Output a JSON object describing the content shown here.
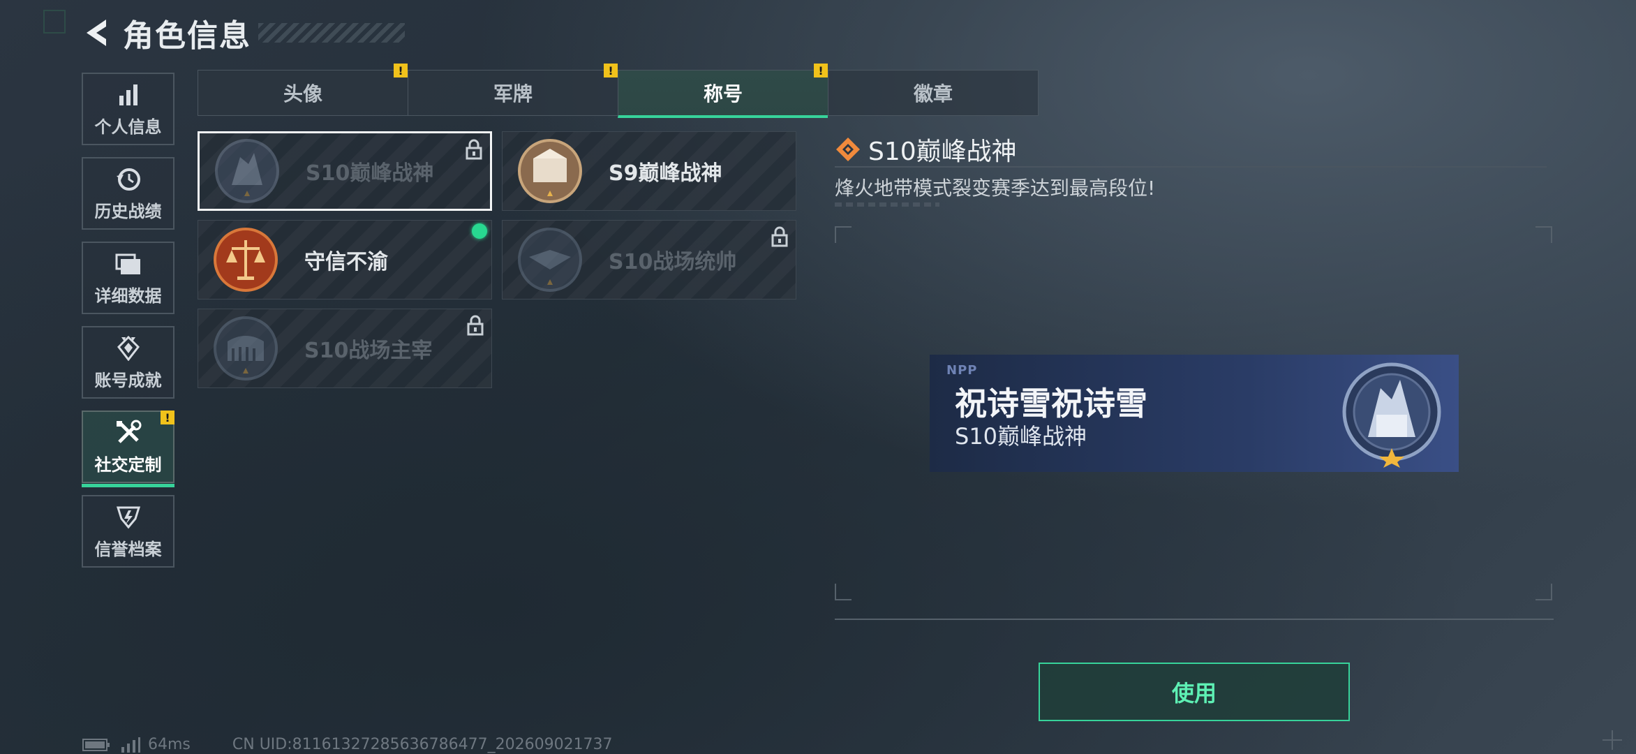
{
  "header": {
    "title": "角色信息"
  },
  "sidebar": {
    "items": [
      {
        "label": "个人信息",
        "icon": "bar-chart-icon"
      },
      {
        "label": "历史战绩",
        "icon": "history-clock-icon"
      },
      {
        "label": "详细数据",
        "icon": "folder-stack-icon"
      },
      {
        "label": "账号成就",
        "icon": "achievement-icon"
      },
      {
        "label": "社交定制",
        "icon": "tools-icon",
        "active": true,
        "alert": "!"
      },
      {
        "label": "信誉档案",
        "icon": "credit-shield-icon"
      }
    ]
  },
  "tabs": [
    {
      "label": "头像",
      "alert": "!"
    },
    {
      "label": "军牌",
      "alert": "!"
    },
    {
      "label": "称号",
      "alert": "!",
      "active": true
    },
    {
      "label": "徽章"
    }
  ],
  "titles": [
    {
      "name": "S10巅峰战神",
      "locked": true,
      "selected": true
    },
    {
      "name": "S9巅峰战神",
      "locked": false
    },
    {
      "name": "守信不渝",
      "locked": false,
      "equipped": true
    },
    {
      "name": "S10战场统帅",
      "locked": true
    },
    {
      "name": "S10战场主宰",
      "locked": true
    }
  ],
  "detail": {
    "name": "S10巅峰战神",
    "description": "烽火地带模式裂变赛季达到最高段位!"
  },
  "preview": {
    "brand": "NPP",
    "player_name": "祝诗雪祝诗雪",
    "title": "S10巅峰战神"
  },
  "actions": {
    "use_label": "使用"
  },
  "footer": {
    "ping": "64ms",
    "uid": "CN UID:8116132728563678647​7_202609021737"
  },
  "colors": {
    "accent": "#37d39a",
    "warning": "#f1c21b",
    "detail_icon": "#f08a3c"
  }
}
